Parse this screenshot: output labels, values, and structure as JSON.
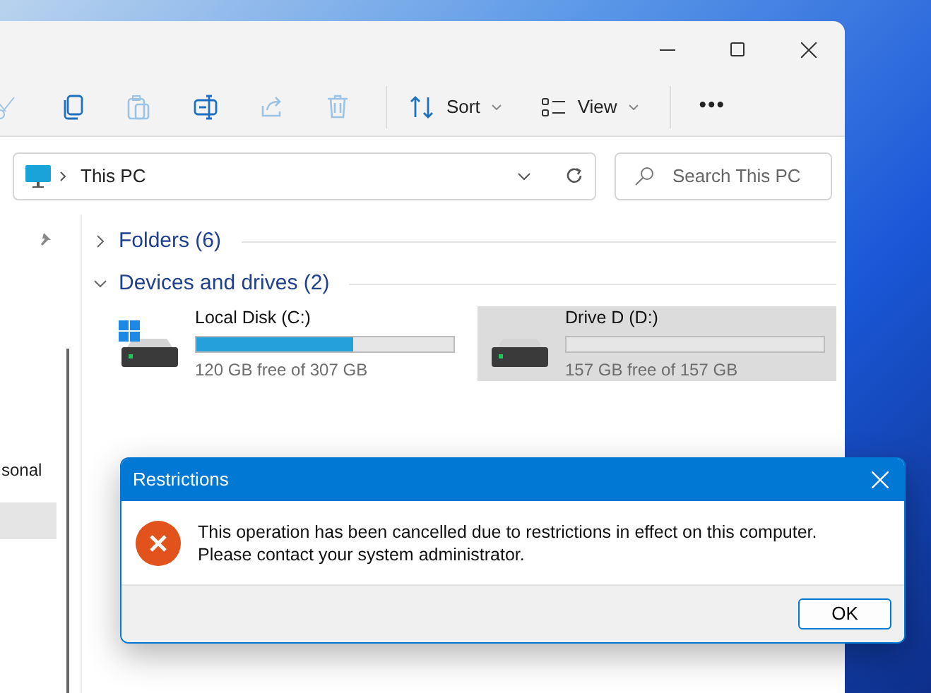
{
  "toolbar": {
    "icon_buttons": [
      {
        "kind": "cut",
        "disabled": true
      },
      {
        "kind": "copy",
        "disabled": false
      },
      {
        "kind": "paste",
        "disabled": true
      },
      {
        "kind": "rename",
        "disabled": false
      },
      {
        "kind": "share",
        "disabled": true
      },
      {
        "kind": "delete",
        "disabled": true
      }
    ],
    "menus": [
      {
        "kind": "sort",
        "label": "Sort"
      },
      {
        "kind": "view",
        "label": "View"
      }
    ],
    "more": "•••"
  },
  "address_bar": {
    "path": "This PC"
  },
  "search": {
    "placeholder": "Search This PC"
  },
  "nav_items": [
    {
      "label": "sonal",
      "selected": false
    },
    {
      "selected": true
    }
  ],
  "sections": [
    {
      "title": "Folders (6)",
      "expanded": false
    },
    {
      "title": "Devices and drives (2)",
      "expanded": true
    }
  ],
  "drives": [
    {
      "name": "Local Disk (C:)",
      "system": true,
      "level": 0.61,
      "free": "120 GB free of 307 GB",
      "selected": false
    },
    {
      "name": "Drive D (D:)",
      "system": false,
      "level": 0,
      "free": "157 GB free of 157 GB",
      "selected": true
    }
  ],
  "dialog": {
    "title": "Restrictions",
    "message": "This operation has been cancelled due to restrictions in effect on this computer. Please contact your system administrator.",
    "button": "OK"
  }
}
